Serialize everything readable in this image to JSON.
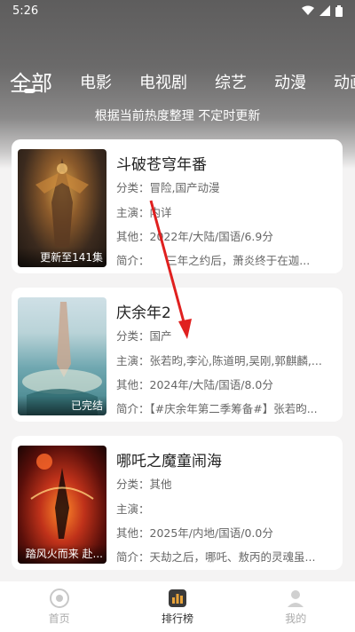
{
  "status": {
    "time": "5:26"
  },
  "tabs": [
    "全部",
    "电影",
    "电视剧",
    "综艺",
    "动漫",
    "动画"
  ],
  "subtitle": "根据当前热度整理 不定时更新",
  "cards": [
    {
      "title": "斗破苍穹年番",
      "poster_badge": "更新至141集",
      "category": "分类：冒险,国产动漫",
      "cast": "主演：内详",
      "other": "其他：2022年/大陆/国语/6.9分",
      "intro": "简介：　　三年之约后，萧炎终于在迦..."
    },
    {
      "title": "庆余年2",
      "poster_badge": "已完结",
      "category": "分类：国产",
      "cast": "主演：张若昀,李沁,陈道明,吴刚,郭麒麟,...",
      "other": "其他：2024年/大陆/国语/8.0分",
      "intro": "简介：【#庆余年第二季筹备#】张若昀..."
    },
    {
      "title": "哪吒之魔童闹海",
      "poster_badge": "踏风火而来 赴...",
      "category": "分类：其他",
      "cast": "主演：",
      "other": "其他：2025年/内地/国语/0.0分",
      "intro": "简介：天劫之后，哪吒、敖丙的灵魂虽..."
    }
  ],
  "nav": [
    {
      "label": "首页",
      "icon": "home-icon"
    },
    {
      "label": "排行榜",
      "icon": "ranking-icon"
    },
    {
      "label": "我的",
      "icon": "profile-icon"
    }
  ],
  "colors": {
    "annotation_arrow": "#e0201f",
    "ranking_accent": "#e8a33a"
  }
}
